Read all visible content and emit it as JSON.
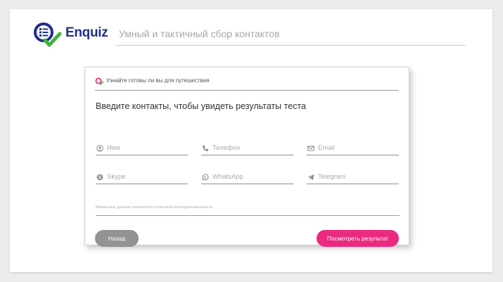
{
  "header": {
    "brand": "Enquiz",
    "tagline": "Умный и тактичный сбор контактов"
  },
  "card": {
    "top_text": "Узнайте готовы ли вы для путешествия",
    "heading": "Введите контакты, чтобы увидеть результаты теста",
    "fields": [
      {
        "label": "Имя",
        "icon": "user-icon"
      },
      {
        "label": "Телефон",
        "icon": "phone-icon"
      },
      {
        "label": "Email",
        "icon": "envelope-icon"
      },
      {
        "label": "Skype",
        "icon": "skype-icon"
      },
      {
        "label": "WhatsApp",
        "icon": "whatsapp-icon"
      },
      {
        "label": "Telegram",
        "icon": "telegram-icon"
      }
    ],
    "privacy": "Введённые данные охраняются политикой конфиденциальности",
    "back_label": "Назад",
    "result_label": "Посмотреть результат"
  },
  "colors": {
    "brand": "#1f2f8a",
    "accent_green": "#3fb63f",
    "primary_button": "#ea2a7f",
    "secondary_button": "#939393"
  }
}
